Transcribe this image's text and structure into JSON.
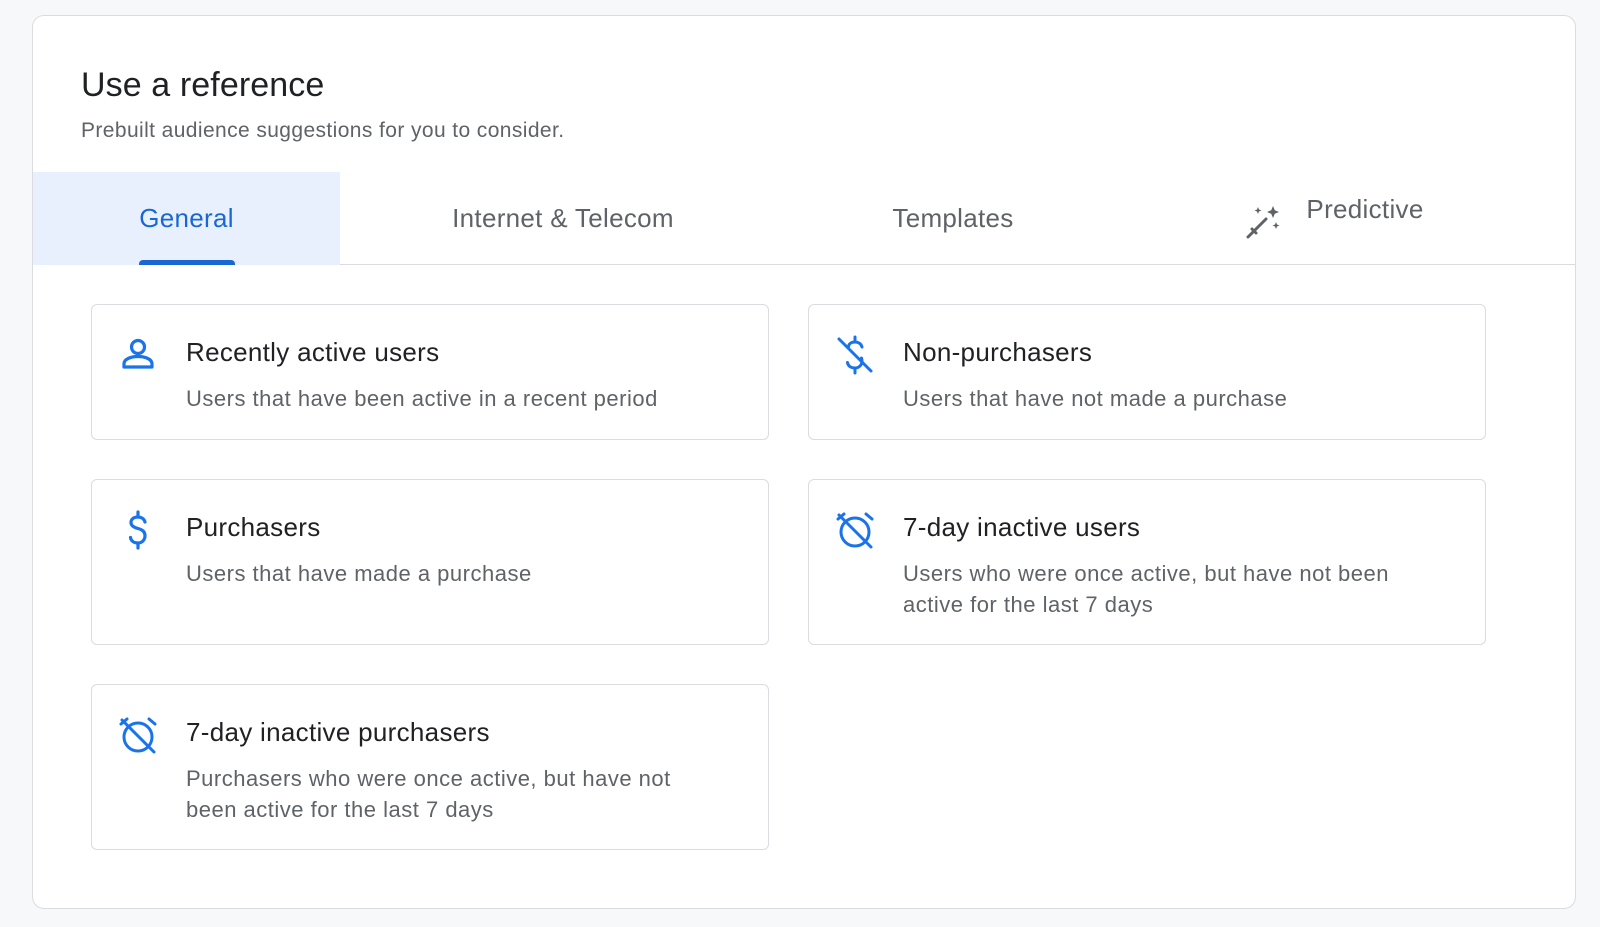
{
  "header": {
    "title": "Use a reference",
    "subtitle": "Prebuilt audience suggestions for you to consider."
  },
  "tabs": [
    {
      "label": "General",
      "active": true
    },
    {
      "label": "Internet & Telecom",
      "active": false
    },
    {
      "label": "Templates",
      "active": false
    },
    {
      "label": "Predictive",
      "active": false,
      "icon": "magic-wand-icon"
    }
  ],
  "cards": [
    {
      "icon": "person-icon",
      "title": "Recently active users",
      "description": "Users that have been active in a recent period"
    },
    {
      "icon": "money-off-icon",
      "title": "Non-purchasers",
      "description": "Users that have not made a purchase"
    },
    {
      "icon": "dollar-icon",
      "title": "Purchasers",
      "description": "Users that have made a purchase"
    },
    {
      "icon": "alarm-off-icon",
      "title": "7-day inactive users",
      "description": "Users who were once active, but have not been active for the last 7 days"
    },
    {
      "icon": "alarm-off-icon",
      "title": "7-day inactive purchasers",
      "description": "Purchasers who were once active, but have not been active for the last 7 days"
    }
  ],
  "colors": {
    "accent": "#1967d2",
    "active_tab_bg": "#e8f0fe",
    "icon_blue": "#1a73e8",
    "text_primary": "#202124",
    "text_secondary": "#5f6368",
    "border": "#dadce0"
  }
}
